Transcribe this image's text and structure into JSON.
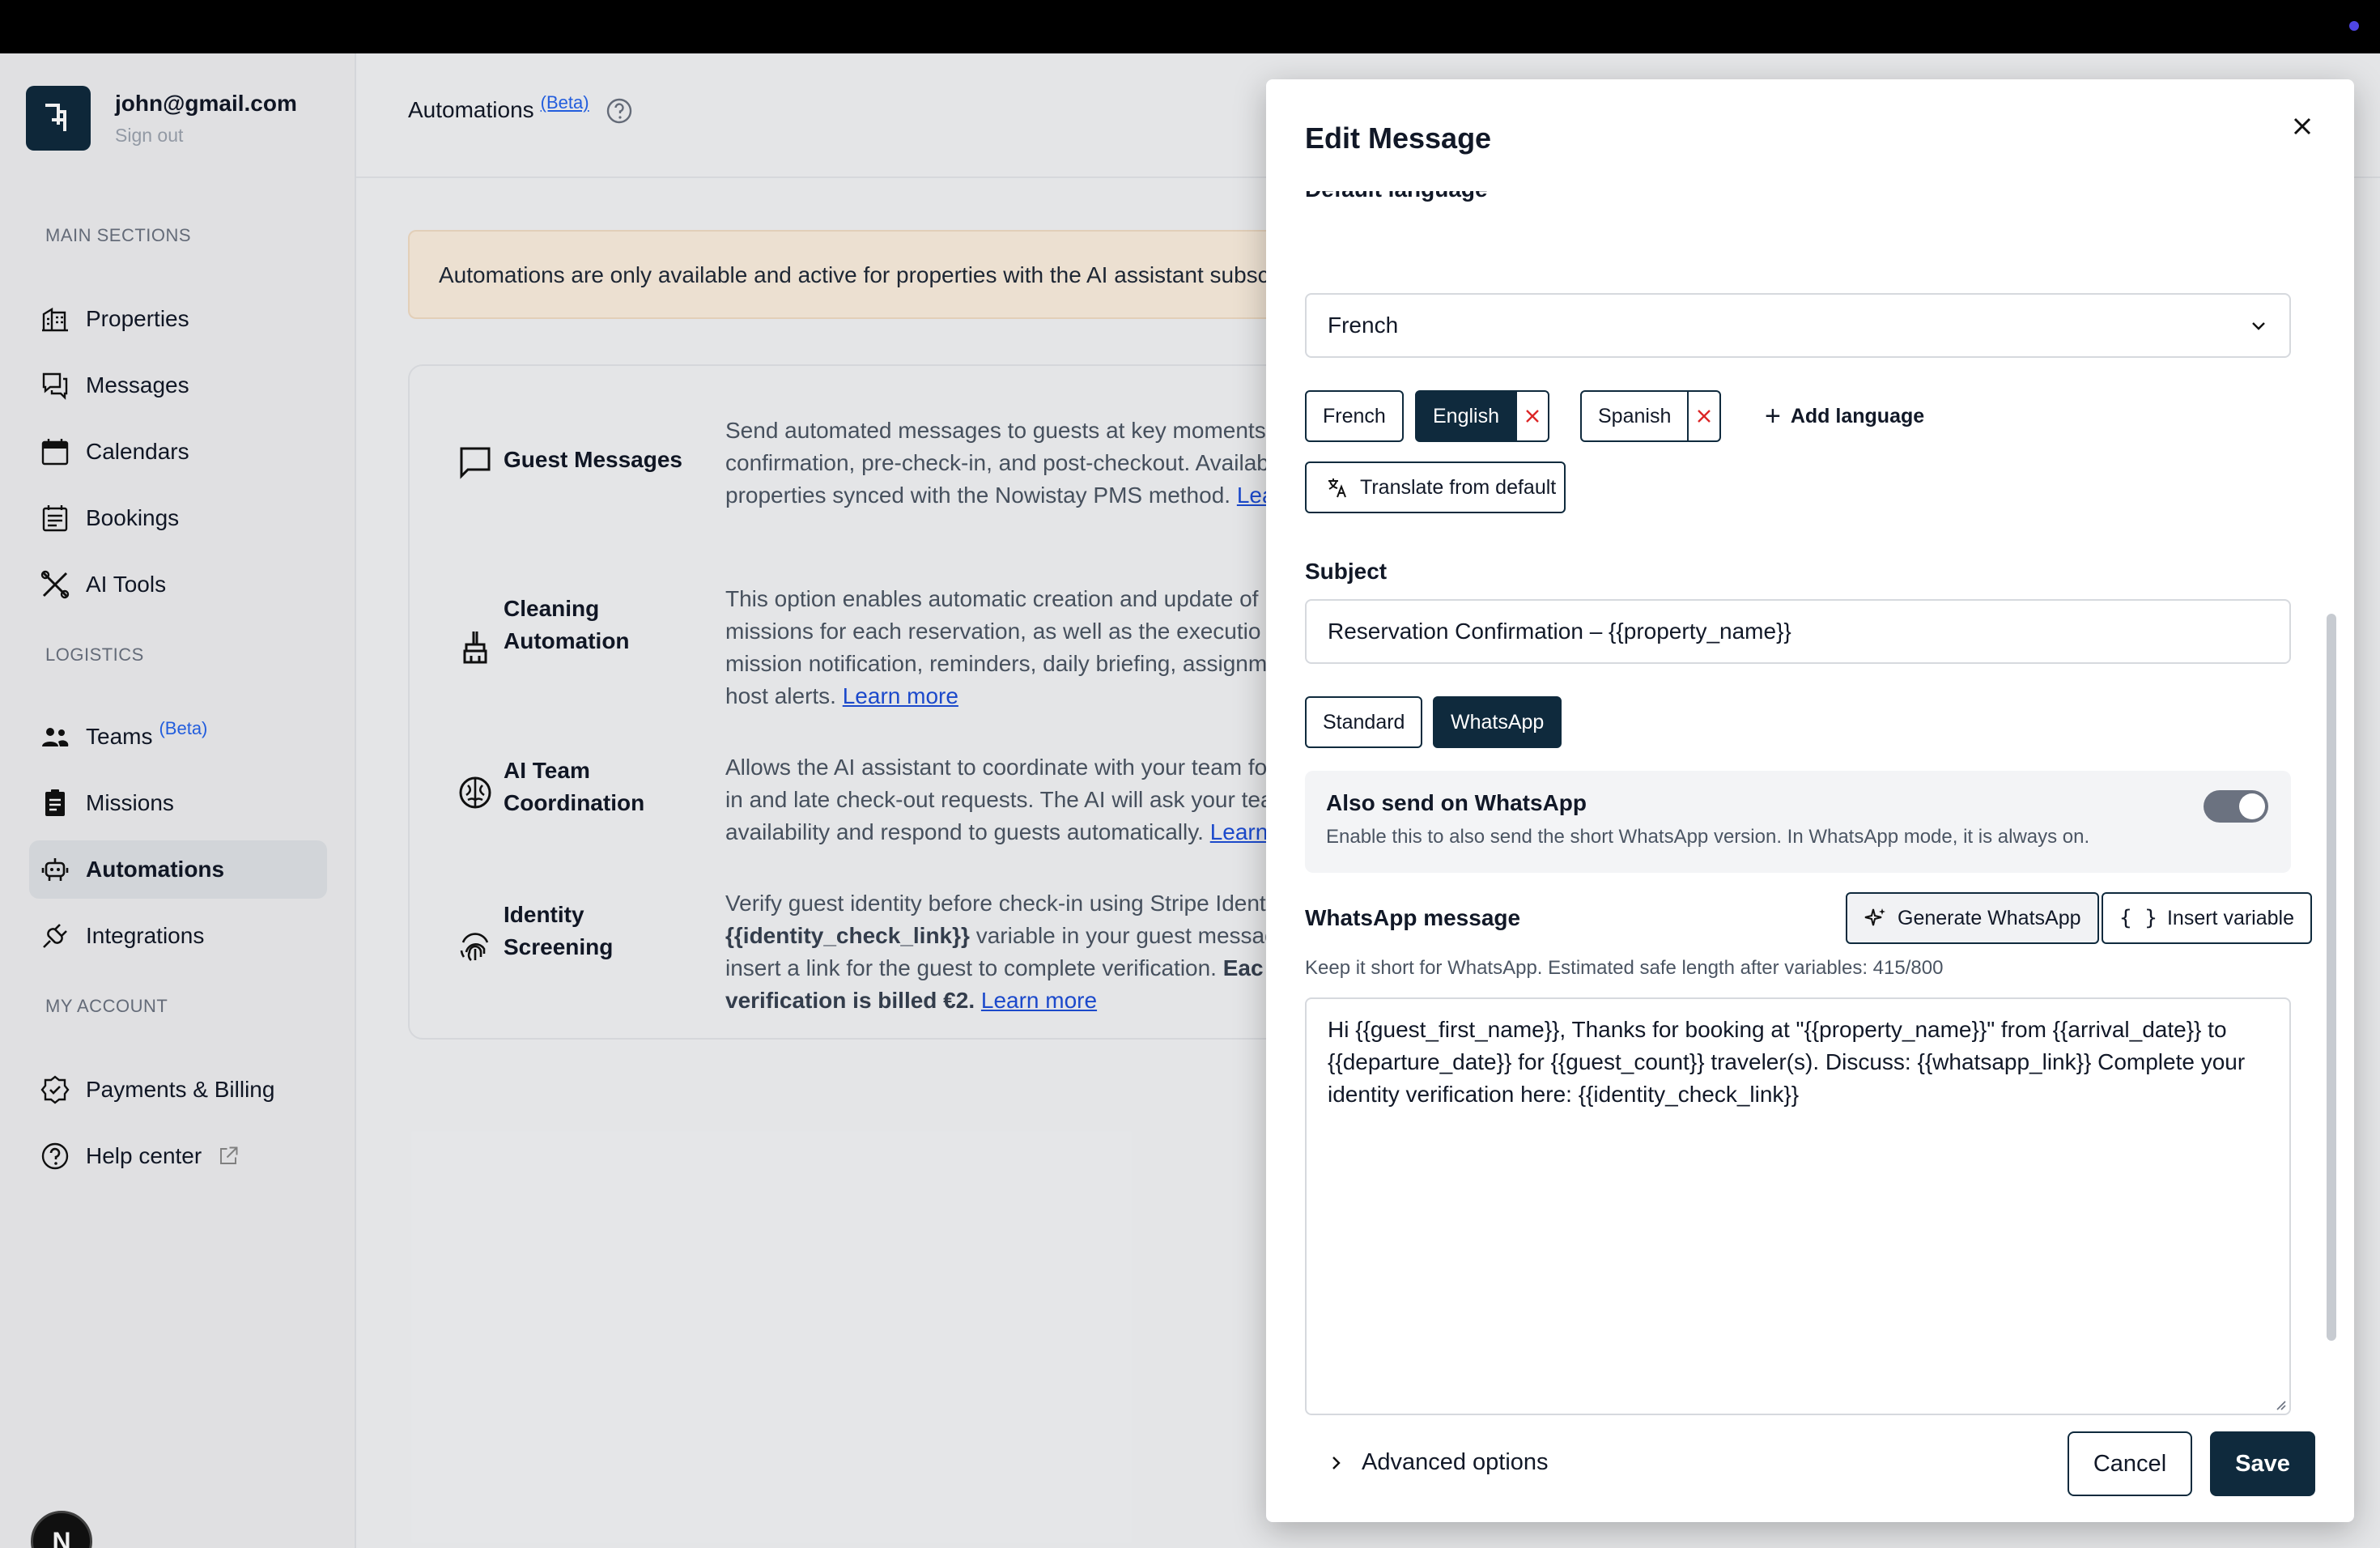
{
  "account": {
    "email": "john@gmail.com",
    "signout": "Sign out"
  },
  "sidebar": {
    "main_label": "MAIN SECTIONS",
    "logistics_label": "LOGISTICS",
    "account_label": "MY ACCOUNT",
    "items": [
      {
        "label": "Properties"
      },
      {
        "label": "Messages"
      },
      {
        "label": "Calendars"
      },
      {
        "label": "Bookings"
      },
      {
        "label": "AI Tools"
      },
      {
        "label": "Teams",
        "badge": "(Beta)"
      },
      {
        "label": "Missions"
      },
      {
        "label": "Automations"
      },
      {
        "label": "Integrations"
      },
      {
        "label": "Payments & Billing"
      },
      {
        "label": "Help center"
      }
    ],
    "bottom_badge": "N"
  },
  "main": {
    "title": "Automations",
    "title_badge": "(Beta)",
    "banner": "Automations are only available and active for properties with the AI assistant subsc",
    "rows": [
      {
        "title": "Guest Messages",
        "desc1": "Send automated messages to guests at key moments",
        "desc2": "confirmation, pre-check-in, and post-checkout. Availab",
        "desc3": "properties synced with the Nowistay PMS method.",
        "link": "Lea"
      },
      {
        "title_1": "Cleaning",
        "title_2": "Automation",
        "desc1": "This option enables automatic creation and update of",
        "desc2": "missions for each reservation, as well as the executio",
        "desc3": "mission notification, reminders, daily briefing, assignm",
        "desc4": "host alerts.",
        "link": "Learn more"
      },
      {
        "title_1": "AI Team",
        "title_2": "Coordination",
        "desc1": "Allows the AI assistant to coordinate with your team fo",
        "desc2": "in and late check-out requests. The AI will ask your tea",
        "desc3": "availability and respond to guests automatically.",
        "link": "Learn"
      },
      {
        "title_1": "Identity",
        "title_2": "Screening",
        "desc1": "Verify guest identity before check-in using Stripe Ident",
        "desc2_b": "{{identity_check_link}}",
        "desc2": " variable in your guest message",
        "desc3": "insert a link for the guest to complete verification.",
        "desc3_b": " Eac",
        "desc4_b": "verification is billed €2.",
        "link": "Learn more"
      }
    ]
  },
  "modal": {
    "title": "Edit Message",
    "cut_label": "Default language",
    "default_language": "French",
    "languages": [
      {
        "label": "French",
        "selected": false,
        "removable": false
      },
      {
        "label": "English",
        "selected": true,
        "removable": true
      },
      {
        "label": "Spanish",
        "selected": false,
        "removable": true
      }
    ],
    "add_language": "Add language",
    "translate": "Translate from default",
    "subject_label": "Subject",
    "subject_value": "Reservation Confirmation – {{property_name}}",
    "mode_standard": "Standard",
    "mode_whatsapp": "WhatsApp",
    "wa_title": "Also send on WhatsApp",
    "wa_sub": "Enable this to also send the short WhatsApp version. In WhatsApp mode, it is always on.",
    "wa_msg_label": "WhatsApp message",
    "generate": "Generate WhatsApp",
    "insert_variable": "Insert variable",
    "hint": "Keep it short for WhatsApp. Estimated safe length after variables: 415/800",
    "message_value": "Hi {{guest_first_name}}, Thanks for booking at \"{{property_name}}\" from {{arrival_date}} to {{departure_date}} for {{guest_count}} traveler(s). Discuss: {{whatsapp_link}} Complete your identity verification here: {{identity_check_link}}",
    "advanced": "Advanced options",
    "cancel": "Cancel",
    "save": "Save"
  },
  "colors": {
    "primary": "#0f2a3d",
    "banner_bg": "#fbeedf",
    "link": "#1d4ed8",
    "beta": "#2563eb",
    "remove_x": "#dc2626"
  }
}
